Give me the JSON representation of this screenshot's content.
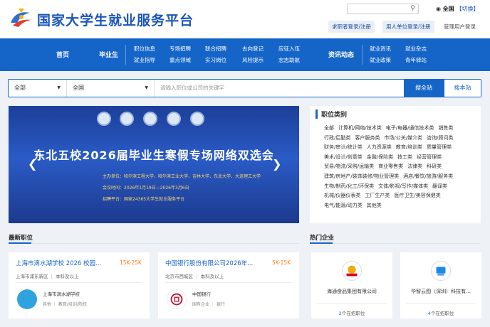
{
  "header": {
    "site_title": "国家大学生就业服务平台",
    "location": "全国",
    "switch_label": "【切换】",
    "student_login": "求职者登录/注册",
    "employer_login": "用人单位登录/注册",
    "admin_login": "管理用户登录"
  },
  "nav": {
    "home": "首页",
    "graduate": "毕业生",
    "graduate_links": [
      "职位信息",
      "专场招聘",
      "联合招聘",
      "去向登记",
      "应征入伍",
      "就业指导",
      "重点领域",
      "实习岗位",
      "风险提示",
      "志志助航"
    ],
    "news": "资讯动态",
    "news_links": [
      "就业资讯",
      "就业杂志",
      "就业政策",
      "青年驿站"
    ]
  },
  "search": {
    "type": "全部",
    "region": "全国",
    "placeholder": "请输入职位或公司的关键字",
    "search_all": "搜全站",
    "search_page": "搜本站"
  },
  "banner": {
    "title": "东北五校2026届毕业生寒假专场网络双选会",
    "line1": "主办单位：哈尔滨工程大学、哈尔滨工业大学、吉林大学、东北大学、大连理工大学",
    "line2": "会议时间：2026年1月19日—2026年3月6日",
    "line3": "招聘平台：国家24365大学生就业服务平台"
  },
  "categories": {
    "heading": "职位类别",
    "items": [
      "全部",
      "计算机/网络/技术类",
      "电子/电器/通信技术类",
      "销售类",
      "行政/后勤类",
      "客户服务类",
      "市场/公关/媒介类",
      "咨询/顾问类",
      "财务/审计/统计类",
      "人力资源类",
      "教育/培训类",
      "质量管理类",
      "美术/设计/创意类",
      "金融/保险类",
      "技工类",
      "经营管理类",
      "贸易/物流/采购/运输类",
      "商业零售类",
      "法律类",
      "科研类",
      "建筑/房地产/装饰装修/物业管理类",
      "酒店/餐饮/旅游/服务类",
      "生物/制药/化工/环保类",
      "文体/影视/写作/媒体类",
      "翻译类",
      "机械/仪器仪表类",
      "工厂生产类",
      "医疗卫生/美容保健类",
      "电气/能源/动力类",
      "其他类"
    ]
  },
  "sections": {
    "latest_jobs": "最新职位",
    "hot_companies": "热门企业"
  },
  "jobs": [
    {
      "title": "上海市滴水湖学校 2026 校园...",
      "salary": "15K-25K",
      "meta": "上海市浦东新区 ｜ 本科及以上",
      "company": "上海市滴水湖学校",
      "tags": "其他 ｜ 教育/培训/院校"
    },
    {
      "title": "中国银行股份有限公司2026年...",
      "salary": "5K-15K",
      "meta": "北京市西城区 ｜ 本科及以上",
      "company": "中国银行",
      "tags": "国有企业 ｜ 银行"
    }
  ],
  "hot": [
    {
      "name": "海通食品集团有限公司",
      "count": "2",
      "unit": "个在招职位",
      "logo_text": "Haitong"
    },
    {
      "name": "华智云图（深圳）科技有...",
      "count": "4",
      "unit": "个在招职位",
      "logo_text": "华智云图"
    }
  ],
  "colors": {
    "primary": "#1565c8",
    "salary": "#ff7a1a",
    "banner": "#1c3f9a"
  }
}
